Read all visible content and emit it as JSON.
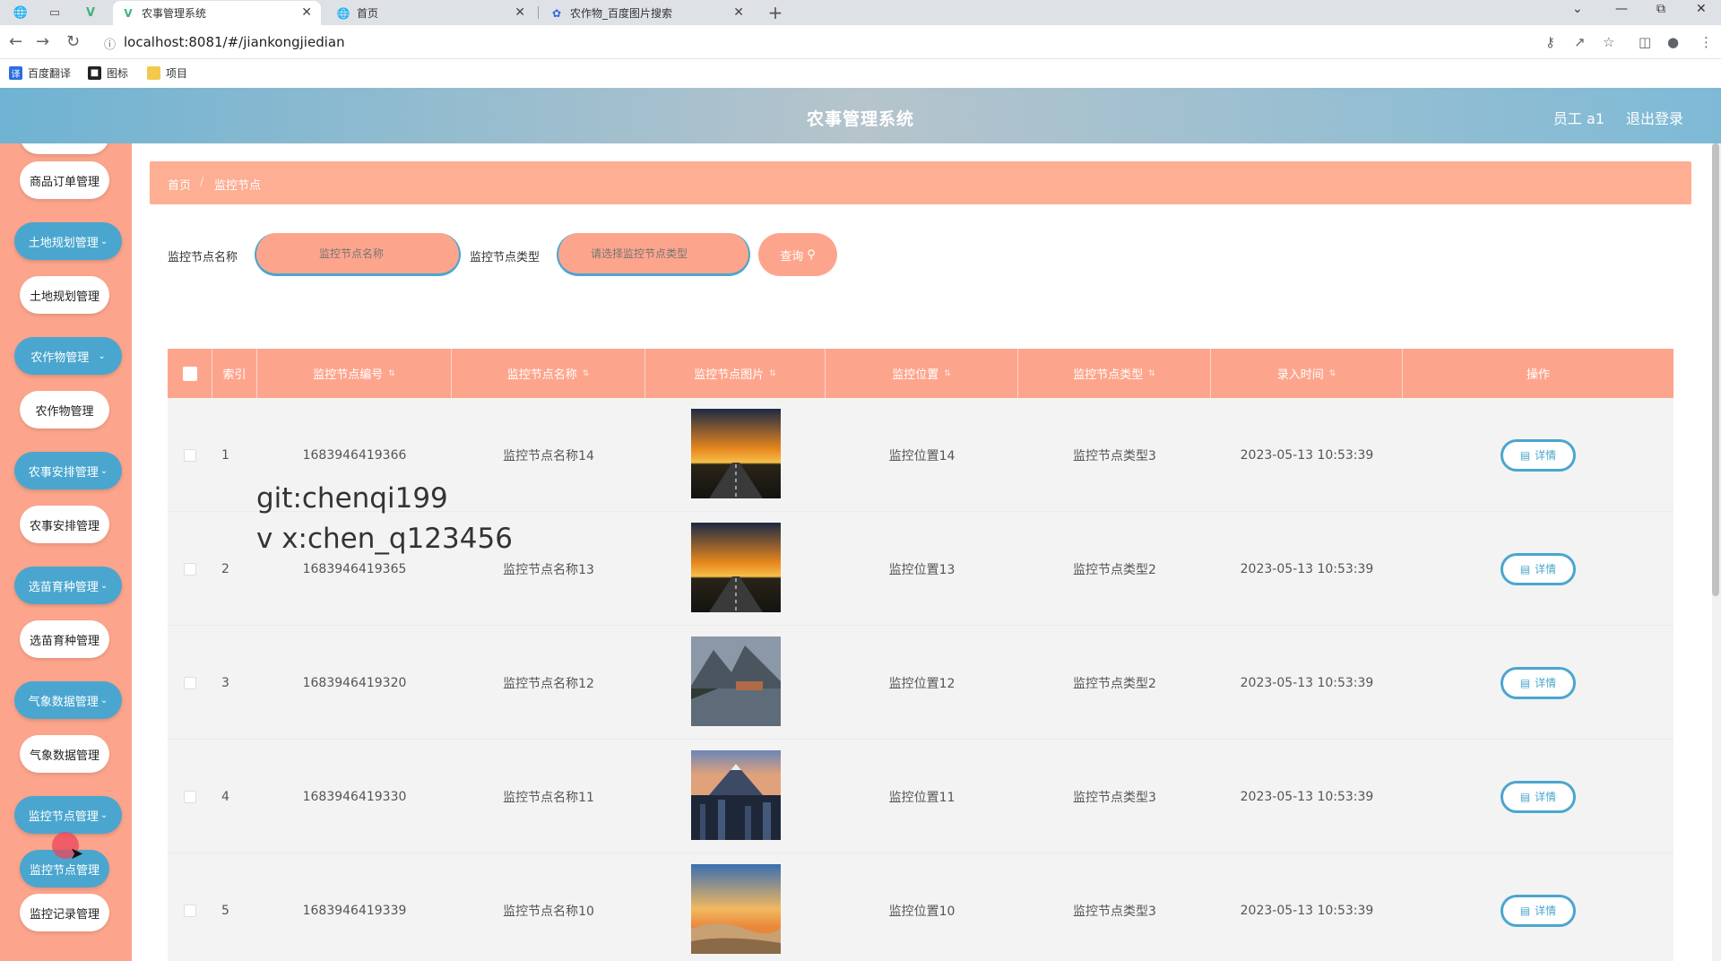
{
  "browser": {
    "tabs": [
      {
        "title": "农事管理系统",
        "icon": "vue-logo-icon"
      },
      {
        "title": "首页",
        "icon": "globe-icon"
      },
      {
        "title": "农作物_百度图片搜索",
        "icon": "baidu-paw-icon"
      }
    ],
    "url": "localhost:8081/#/jiankongjiedian",
    "bookmarks": [
      {
        "label": "百度翻译",
        "icon": "translate-icon"
      },
      {
        "label": "图标",
        "icon": "image-icon"
      },
      {
        "label": "项目",
        "icon": "folder-icon"
      }
    ]
  },
  "header": {
    "title": "农事管理系统",
    "user": "员工 a1",
    "logout": "退出登录"
  },
  "sidebar": {
    "items": [
      {
        "label": "商品订单管理",
        "type": "child"
      },
      {
        "label": "土地规划管理",
        "type": "parent"
      },
      {
        "label": "土地规划管理",
        "type": "child"
      },
      {
        "label": "农作物管理",
        "type": "parent"
      },
      {
        "label": "农作物管理",
        "type": "child"
      },
      {
        "label": "农事安排管理",
        "type": "parent"
      },
      {
        "label": "农事安排管理",
        "type": "child"
      },
      {
        "label": "选苗育种管理",
        "type": "parent"
      },
      {
        "label": "选苗育种管理",
        "type": "child"
      },
      {
        "label": "气象数据管理",
        "type": "parent"
      },
      {
        "label": "气象数据管理",
        "type": "child"
      },
      {
        "label": "监控节点管理",
        "type": "parent"
      },
      {
        "label": "监控节点管理",
        "type": "child-active"
      },
      {
        "label": "监控记录管理",
        "type": "child"
      }
    ]
  },
  "breadcrumb": {
    "home": "首页",
    "sep": "/",
    "current": "监控节点"
  },
  "search": {
    "name_label": "监控节点名称",
    "name_placeholder": "监控节点名称",
    "type_label": "监控节点类型",
    "type_placeholder": "请选择监控节点类型",
    "button": "查询"
  },
  "table": {
    "headers": {
      "index": "索引",
      "code": "监控节点编号",
      "name": "监控节点名称",
      "image": "监控节点图片",
      "location": "监控位置",
      "type": "监控节点类型",
      "time": "录入时间",
      "action": "操作"
    },
    "detail_label": "详情",
    "rows": [
      {
        "index": "1",
        "code": "1683946419366",
        "name": "监控节点名称14",
        "location": "监控位置14",
        "type": "监控节点类型3",
        "time": "2023-05-13 10:53:39",
        "image": "sunset-road"
      },
      {
        "index": "2",
        "code": "1683946419365",
        "name": "监控节点名称13",
        "location": "监控位置13",
        "type": "监控节点类型2",
        "time": "2023-05-13 10:53:39",
        "image": "sunset-road"
      },
      {
        "index": "3",
        "code": "1683946419320",
        "name": "监控节点名称12",
        "location": "监控位置12",
        "type": "监控节点类型2",
        "time": "2023-05-13 10:53:39",
        "image": "mountain-lake"
      },
      {
        "index": "4",
        "code": "1683946419330",
        "name": "监控节点名称11",
        "location": "监控位置11",
        "type": "监控节点类型3",
        "time": "2023-05-13 10:53:39",
        "image": "city-mountain"
      },
      {
        "index": "5",
        "code": "1683946419339",
        "name": "监控节点名称10",
        "location": "监控位置10",
        "type": "监控节点类型3",
        "time": "2023-05-13 10:53:39",
        "image": "desert-sunset"
      }
    ]
  },
  "watermark": {
    "line1": "git:chenqi199",
    "line2": "v x:chen_q123456"
  },
  "colors": {
    "accent": "#4aa6cf",
    "salmon": "#fda58c"
  }
}
